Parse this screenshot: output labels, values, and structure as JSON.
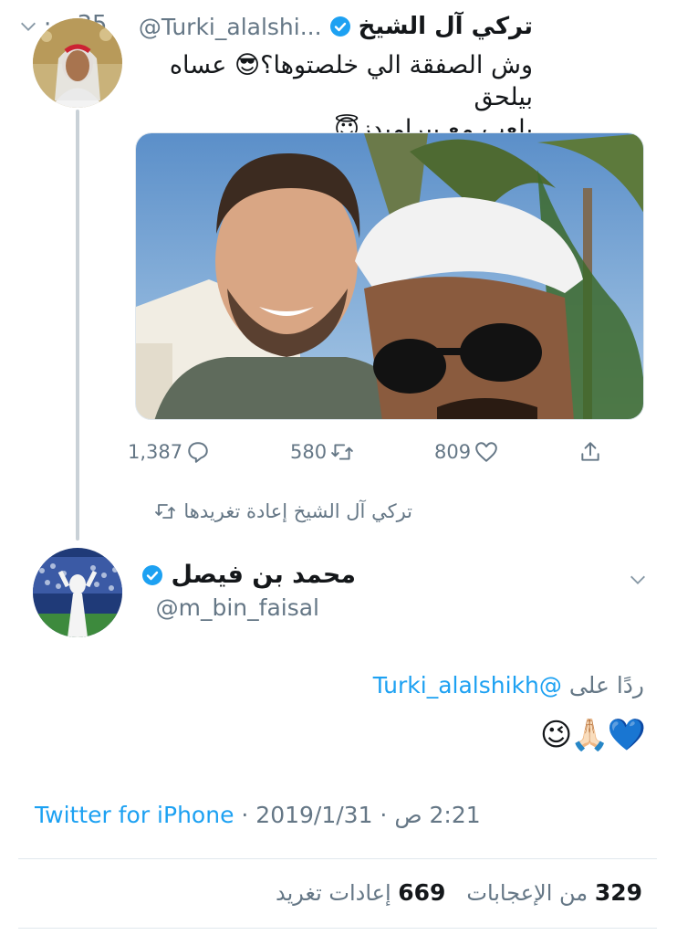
{
  "parent_tweet": {
    "display_name": "تركي آل الشيخ",
    "handle": "@Turki_alalshi...",
    "time": "35 د · ",
    "text_line1": "وش الصفقة الي خلصتوها؟😎 عساه بيلحق",
    "text_line2": "يلعب مع بيراميدز😇",
    "reply_count": "1,387",
    "retweet_count": "580",
    "like_count": "809"
  },
  "retweeted_by_label": "تركي آل الشيخ إعادة تغريدها",
  "main_tweet": {
    "display_name": "محمد بن فيصل",
    "handle": "@m_bin_faisal",
    "reply_to_prefix": "ردًا على",
    "reply_to_handle": "@Turki_alalshikh",
    "emojis": "😉🙏🏻💙",
    "source": "Twitter for iPhone",
    "sep1": " · ",
    "date": "2019/1/31",
    "sep2": " · ",
    "time": "2:21 ص",
    "likes_value": "329",
    "likes_label": "من الإعجابات",
    "retweets_value": "669",
    "retweets_label": "إعادات تغريد"
  },
  "colors": {
    "accent": "#1da1f2",
    "secondary_text": "#657786",
    "primary_text": "#14171a",
    "thread_line": "#c9d1d7"
  },
  "icons": [
    "chevron-down-icon",
    "verified-badge-icon",
    "reply-icon",
    "retweet-icon",
    "like-icon",
    "share-icon"
  ]
}
